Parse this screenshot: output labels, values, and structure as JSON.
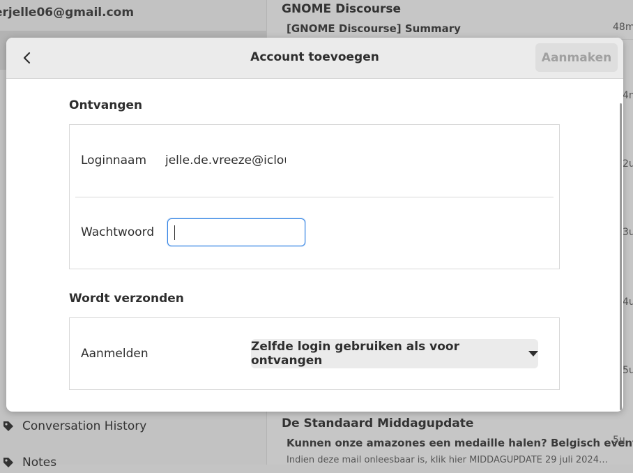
{
  "background": {
    "account_email": "erjelle06@gmail.com",
    "folders": [
      {
        "label": "Conversation History"
      },
      {
        "label": "Notes"
      }
    ],
    "messages": [
      {
        "sender": "GNOME Discourse",
        "subject": "[GNOME Discourse] Summary",
        "time": "48m"
      },
      {
        "sender": "De Standaard Middagupdate",
        "subject": "Kunnen onze amazones een medaille halen? Belgisch event…",
        "preview": "Indien deze mail onleesbaar is, klik hier MIDDAGUPDATE 29 juli 2024…",
        "time": "5u"
      }
    ],
    "partial_times": [
      "4m",
      "2u",
      "3u",
      "4u",
      "5u"
    ]
  },
  "dialog": {
    "title": "Account toevoegen",
    "create_label": "Aanmaken",
    "receive": {
      "section_title": "Ontvangen",
      "login_label": "Loginnaam",
      "login_value": "jelle.de.vreeze@iclou",
      "password_label": "Wachtwoord",
      "password_value": ""
    },
    "send": {
      "section_title": "Wordt verzonden",
      "auth_label": "Aanmelden",
      "auth_selected": "Zelfde login gebruiken als voor ontvangen"
    }
  }
}
